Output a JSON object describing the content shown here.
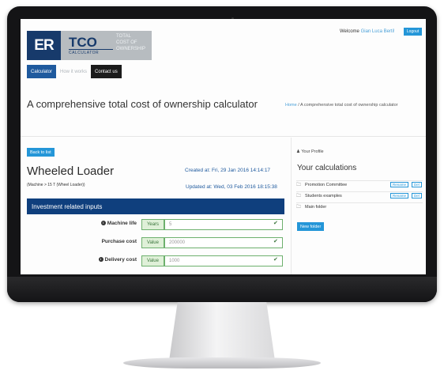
{
  "header": {
    "logo_mark": "ER",
    "logo_name": "TCO",
    "logo_small": "CALCULATOR",
    "logo_sub_1": "TOTAL",
    "logo_sub_2": "COST OF",
    "logo_sub_3": "OWNERSHIP",
    "welcome": "Welcome",
    "user": "Gian Luca Berti!",
    "logout": "Logout"
  },
  "nav": [
    "Calculator",
    "How it works",
    "Contact us"
  ],
  "banner": {
    "title": "A comprehensive total cost of ownership calculator",
    "crumb_home": "Home",
    "crumb_sep": "/",
    "crumb_current": "A comprehensive total cost of ownership calculator"
  },
  "main": {
    "back": "Back to list",
    "title": "Wheeled Loader",
    "path": "(Machine > 15 T (Wheel Loader))",
    "created": "Created at: Fri, 29 Jan 2016 14:14:17",
    "updated": "Updated at: Wed, 03 Feb 2016 18:15:38",
    "section": "Investment related inputs",
    "fields": [
      {
        "label": "Machine life",
        "unit": "Years",
        "value": "5"
      },
      {
        "label": "Purchase cost",
        "unit": "Value",
        "value": "200000"
      },
      {
        "label": "Delivery cost",
        "unit": "Value",
        "value": "1000"
      }
    ]
  },
  "sidebar": {
    "profile": "Your Profile",
    "title": "Your calculations",
    "folders": [
      "Promotion Committee",
      "Students examples",
      "Main folder"
    ],
    "rename": "Rename",
    "del": "Del",
    "new_folder": "New folder"
  },
  "colors": {
    "primary": "#2496d8",
    "navy": "#0f3f7d",
    "success": "#3c763d"
  }
}
